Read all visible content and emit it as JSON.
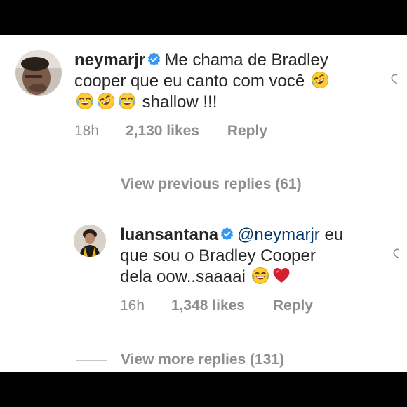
{
  "comment": {
    "username": "neymarjr",
    "text_line1": "Me chama de Bradley",
    "text_line2": "cooper que eu canto com você",
    "text_line3_tail": "shallow !!!",
    "time": "18h",
    "likes": "2,130 likes",
    "reply_label": "Reply"
  },
  "view_previous": "View previous replies (61)",
  "reply": {
    "username": "luansantana",
    "mention": "@neymarjr",
    "text_line1_tail": "eu",
    "text_line2": "que sou o Bradley Cooper",
    "text_line3": "dela oow..saaaai",
    "time": "16h",
    "likes": "1,348 likes",
    "reply_label": "Reply"
  },
  "view_more": "View more replies (131)",
  "colors": {
    "text": "#262626",
    "secondary": "#8e8e8e",
    "verified": "#3897f0",
    "mention": "#00376b",
    "heart_emoji": "#d4202c"
  },
  "icons": {
    "verified": "verified-badge-icon",
    "rofl": "rofl-emoji-icon",
    "joy": "joy-emoji-icon",
    "heart": "red-heart-emoji-icon",
    "like": "heart-outline-icon"
  }
}
